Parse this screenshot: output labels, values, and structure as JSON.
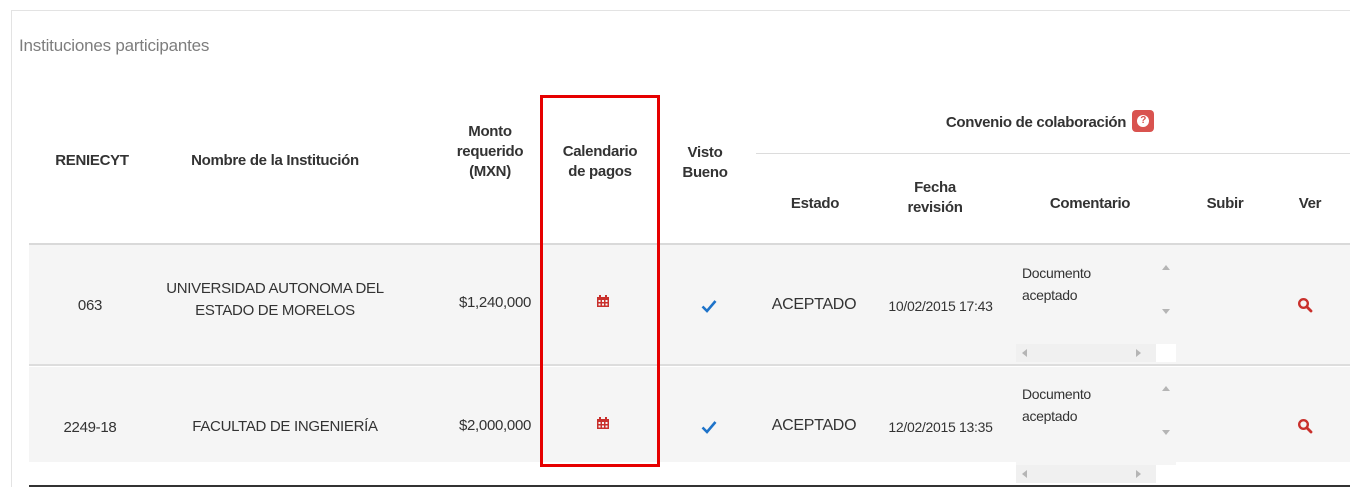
{
  "panel": {
    "title": "Instituciones participantes"
  },
  "table": {
    "headers": {
      "reniecyt": "RENIECYT",
      "nombre": "Nombre de la Institución",
      "monto_l1": "Monto",
      "monto_l2": "requerido",
      "monto_l3": "(MXN)",
      "calendario_l1": "Calendario",
      "calendario_l2": "de pagos",
      "visto_l1": "Visto",
      "visto_l2": "Bueno",
      "convenio": "Convenio de colaboración",
      "estado": "Estado",
      "fecha_l1": "Fecha",
      "fecha_l2": "revisión",
      "comentario": "Comentario",
      "subir": "Subir",
      "ver": "Ver"
    },
    "rows": [
      {
        "reniecyt": "063",
        "nombre_l1": "UNIVERSIDAD AUTONOMA DEL",
        "nombre_l2": "ESTADO DE MORELOS",
        "monto": "$1,240,000",
        "estado": "ACEPTADO",
        "fecha": "10/02/2015 17:43",
        "comentario_l1": "Documento",
        "comentario_l2": "aceptado"
      },
      {
        "reniecyt": "2249-18",
        "nombre_l1": "FACULTAD DE INGENIERÍA",
        "nombre_l2": "",
        "monto": "$2,000,000",
        "estado": "ACEPTADO",
        "fecha": "12/02/2015 13:35",
        "comentario_l1": "Documento",
        "comentario_l2": "aceptado"
      }
    ]
  },
  "icons": {
    "calendar": "calendar-icon",
    "check": "check-icon",
    "search": "search-icon",
    "info": "info-icon"
  },
  "colors": {
    "badge": "#d9534f",
    "calendar": "#c9302c",
    "check": "#1e73c9",
    "search": "#c9302c",
    "highlight": "#e60000"
  }
}
